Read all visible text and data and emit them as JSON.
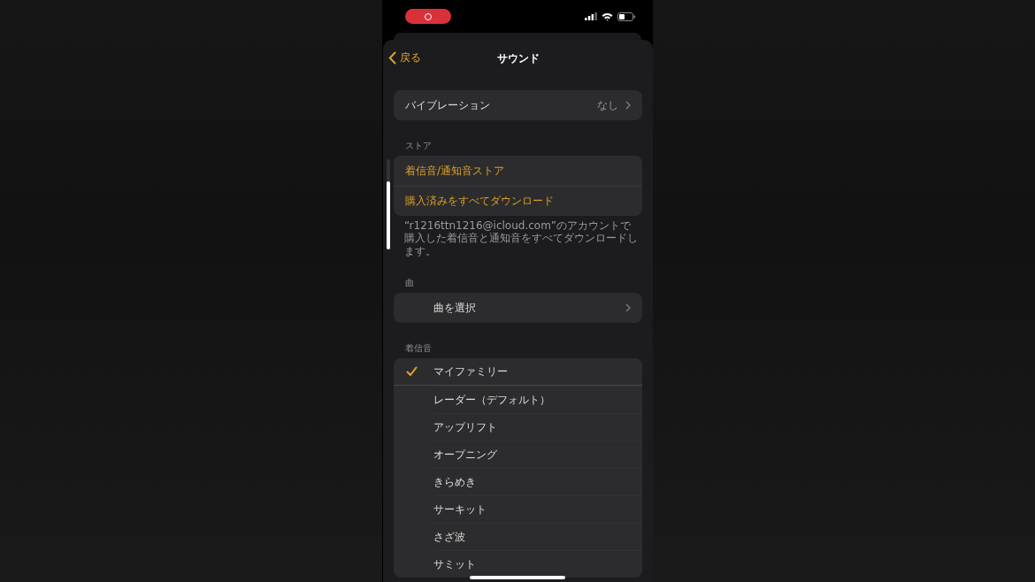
{
  "status_bar": {
    "recording": true
  },
  "nav": {
    "back": "戻る",
    "title": "サウンド"
  },
  "vibration": {
    "label": "バイブレーション",
    "value": "なし"
  },
  "store": {
    "header": "ストア",
    "items": [
      "着信音/通知音ストア",
      "購入済みをすべてダウンロード"
    ],
    "footnote": "“r1216ttn1216@icloud.com”のアカウントで購入した着信音と通知音をすべてダウンロードします。"
  },
  "songs": {
    "header": "曲",
    "row": "曲を選択"
  },
  "ringtones": {
    "header": "着信音",
    "items": [
      {
        "label": "マイファミリー",
        "selected": true
      },
      {
        "label": "レーダー（デフォルト）",
        "selected": false
      },
      {
        "label": "アップリフト",
        "selected": false
      },
      {
        "label": "オープニング",
        "selected": false
      },
      {
        "label": "きらめき",
        "selected": false
      },
      {
        "label": "サーキット",
        "selected": false
      },
      {
        "label": "さざ波",
        "selected": false
      },
      {
        "label": "サミット",
        "selected": false
      }
    ]
  }
}
